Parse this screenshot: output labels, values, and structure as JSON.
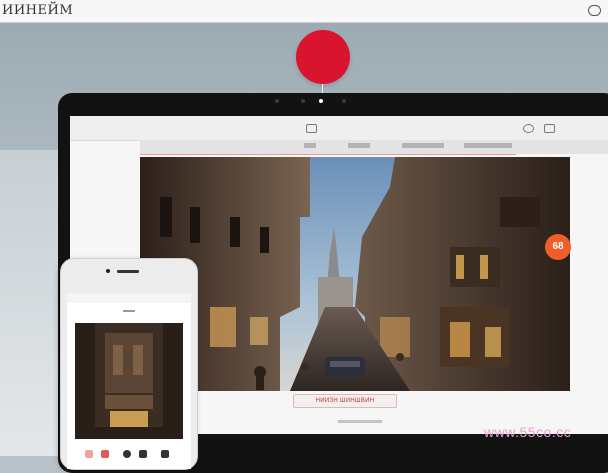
{
  "brand": {
    "name": "ИИНЕЙМ"
  },
  "topbar": {
    "menu_icon": "search-icon"
  },
  "record_button": {
    "color": "#d8142e"
  },
  "app": {
    "toolbar_label": "",
    "menu_items": [
      "",
      "",
      "",
      ""
    ]
  },
  "photo": {
    "subject": "gothic-street-scene"
  },
  "footer": {
    "badge_text": "НИИЗН ШИНШВИН"
  },
  "badge": {
    "label": "68",
    "color": "#f15c2b"
  },
  "phone": {
    "toolbar_icons": [
      "red-icon",
      "red-icon",
      "dark-icon",
      "dark-icon",
      "dark-icon"
    ]
  },
  "watermark": {
    "text": "www.55co.cc"
  }
}
